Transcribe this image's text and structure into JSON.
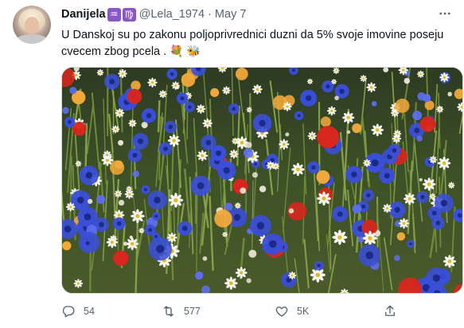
{
  "tweet": {
    "display_name": "Danijela",
    "zodiac_badges": [
      "♒",
      "♍"
    ],
    "handle": "@Lela_1974",
    "separator": "·",
    "date": "May 7",
    "more_icon": "more-horizontal-icon",
    "text": "U Danskoj su po zakonu poljoprivrednici duzni da 5% svoje imovine poseju cvecem zbog pcela .",
    "emojis": [
      "💐",
      "🐝"
    ],
    "image_description_icon": "wildflower-meadow-photo"
  },
  "actions": {
    "reply": {
      "icon": "reply-icon",
      "count": "54"
    },
    "retweet": {
      "icon": "retweet-icon",
      "count": "577"
    },
    "like": {
      "icon": "heart-icon",
      "count": "5K"
    },
    "share": {
      "icon": "share-icon"
    }
  },
  "colors": {
    "text_primary": "#0f1419",
    "text_secondary": "#536471",
    "border": "#cfd9de",
    "badge_purple": "#8a55c8"
  }
}
